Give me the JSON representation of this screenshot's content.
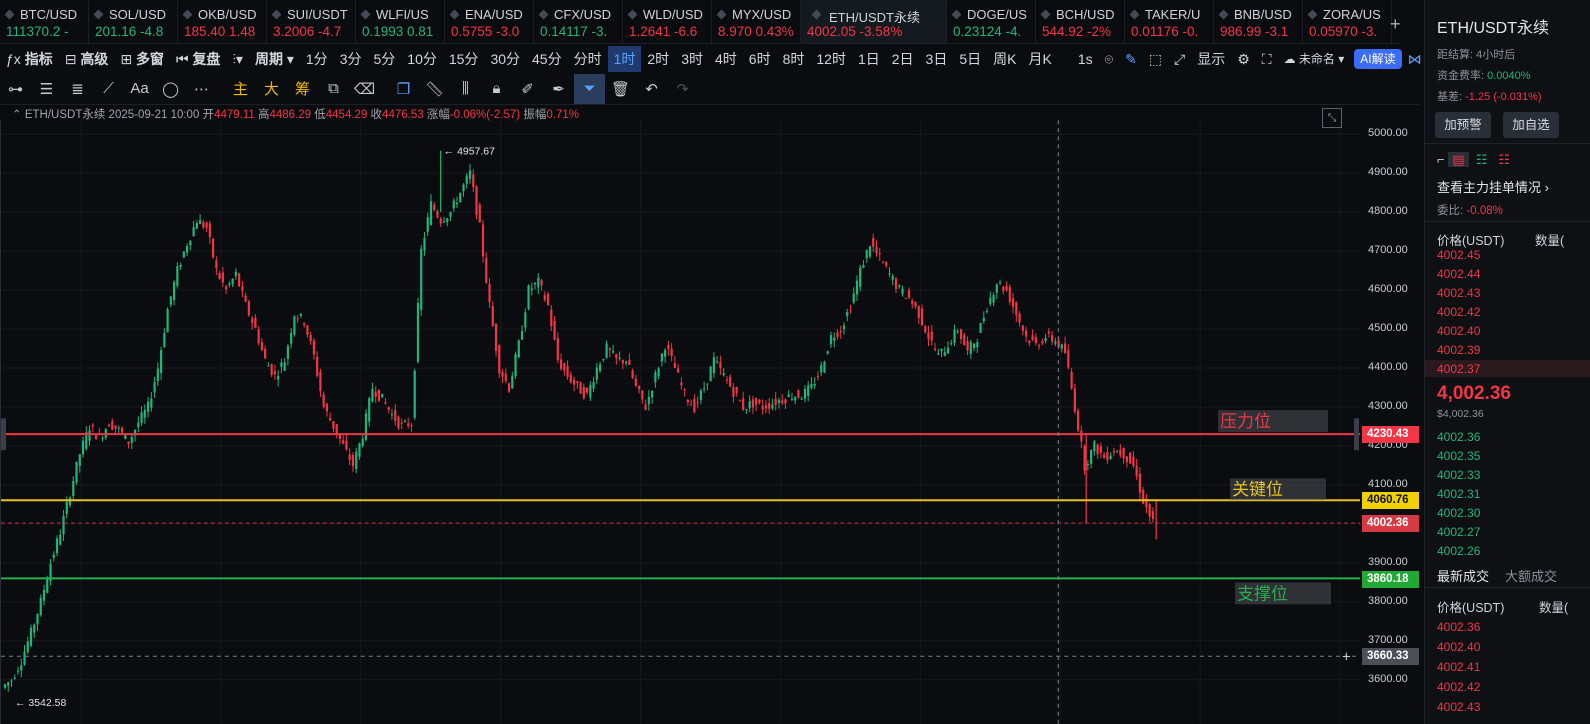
{
  "tickers": [
    {
      "sym": "BTC/USD",
      "val": "111370.2 -",
      "color": "#1fb67a"
    },
    {
      "sym": "SOL/USD",
      "val": "201.16 -4.8",
      "color": "#1fb67a"
    },
    {
      "sym": "OKB/USD",
      "val": "185.40 1.48",
      "color": "#f23645"
    },
    {
      "sym": "SUI/USDT",
      "val": "3.2006 -4.7",
      "color": "#f23645"
    },
    {
      "sym": "WLFI/US",
      "val": "0.1993 0.81",
      "color": "#1fb67a"
    },
    {
      "sym": "ENA/USD",
      "val": "0.5755 -3.0",
      "color": "#f23645"
    },
    {
      "sym": "CFX/USD",
      "val": "0.14117 -3.",
      "color": "#1fb67a"
    },
    {
      "sym": "WLD/USD",
      "val": "1.2641 -6.6",
      "color": "#f23645"
    },
    {
      "sym": "MYX/USD",
      "val": "8.970 0.43%",
      "color": "#f23645"
    },
    {
      "sym": "ETH/USDT永续",
      "val": "4002.05 -3.58%",
      "color": "#f23645",
      "active": true
    },
    {
      "sym": "DOGE/US",
      "val": "0.23124 -4.",
      "color": "#1fb67a"
    },
    {
      "sym": "BCH/USD",
      "val": "544.92 -2%",
      "color": "#f23645"
    },
    {
      "sym": "TAKER/U",
      "val": "0.01176 -0.",
      "color": "#f23645"
    },
    {
      "sym": "BNB/USD",
      "val": "986.99 -3.1",
      "color": "#f23645"
    },
    {
      "sym": "ZORA/US",
      "val": "0.05970 -3.",
      "color": "#f23645"
    }
  ],
  "toolbar1": {
    "indicator": "指标",
    "advanced": "高级",
    "multi": "多窗",
    "replay": "复盘",
    "period": "周期",
    "intervals": [
      "1分",
      "3分",
      "5分",
      "10分",
      "15分",
      "30分",
      "45分",
      "分时",
      "1时",
      "2时",
      "3时",
      "4时",
      "6时",
      "8时",
      "12时",
      "1日",
      "2日",
      "3日",
      "5日",
      "周K",
      "月K"
    ],
    "active_interval": "1时",
    "sec": "1s",
    "display": "显示",
    "unnamed": "未命名",
    "ai": "AI解读"
  },
  "toolbar2": {
    "main": "主",
    "big": "大",
    "chip": "筹",
    "text_tool": "Aa"
  },
  "info": {
    "pair": "ETH/USDT永续",
    "time": "2025-09-21 10:00",
    "open_l": "开",
    "open": "4479.11",
    "high_l": "高",
    "high": "4486.29",
    "low_l": "低",
    "low": "4454.29",
    "close_l": "收",
    "close": "4476.53",
    "chg_l": "涨幅",
    "chg": "-0.06%(-2.57)",
    "amp_l": "振幅",
    "amp": "0.71%"
  },
  "chart_data": {
    "type": "line",
    "title": "ETH/USDT永续 1时",
    "ylim": [
      3560,
      5040
    ],
    "yticks": [
      5000,
      4900,
      4800,
      4700,
      4600,
      4500,
      4400,
      4300,
      4200,
      4100,
      4000,
      3900,
      3800,
      3700,
      3600
    ],
    "high_marker": "4957.67",
    "low_marker": "3542.58",
    "levels": [
      {
        "name": "压力位",
        "value": 4230.43,
        "label": "4230.43",
        "color": "#f23645"
      },
      {
        "name": "关键位",
        "value": 4060.76,
        "label": "4060.76",
        "color": "#e6c31e"
      },
      {
        "name": "支撑位",
        "value": 3860.18,
        "label": "3860.18",
        "color": "#22b14c"
      }
    ],
    "last_price": {
      "value": 4002.36,
      "label": "4002.36"
    },
    "crosshair": {
      "value": 3660.33,
      "label": "3660.33"
    },
    "series": [
      {
        "values": [
          3580,
          3600,
          3650,
          3720,
          3800,
          3900,
          3980,
          4080,
          4180,
          4250,
          4220,
          4260,
          4240,
          4210,
          4260,
          4300,
          4400,
          4550,
          4650,
          4720,
          4780,
          4760,
          4650,
          4600,
          4640,
          4560,
          4500,
          4420,
          4380,
          4420,
          4540,
          4520,
          4430,
          4300,
          4250,
          4200,
          4150,
          4230,
          4350,
          4320,
          4280,
          4250,
          4260,
          4700,
          4820,
          4780,
          4800,
          4850,
          4900,
          4760,
          4560,
          4400,
          4350,
          4460,
          4600,
          4620,
          4560,
          4420,
          4380,
          4350,
          4330,
          4400,
          4450,
          4420,
          4420,
          4350,
          4300,
          4380,
          4460,
          4400,
          4330,
          4300,
          4350,
          4420,
          4380,
          4340,
          4300,
          4310,
          4300,
          4310,
          4320,
          4330,
          4330,
          4350,
          4400,
          4480,
          4500,
          4560,
          4650,
          4720,
          4680,
          4640,
          4600,
          4580,
          4540,
          4480,
          4430,
          4460,
          4500,
          4440,
          4480,
          4560,
          4620,
          4600,
          4540,
          4480,
          4460,
          4480,
          4470,
          4440,
          4300,
          4150,
          4200,
          4170,
          4190,
          4180,
          4150,
          4060,
          4002
        ]
      }
    ]
  },
  "right_panel": {
    "title": "ETH/USDT永续",
    "settle_l": "距结算:",
    "settle": "4小时后",
    "fund_l": "资金费率:",
    "fund": "0.0040%",
    "basis_l": "基差:",
    "basis": "-1.25 (-0.031%)",
    "alert_btn": "加预警",
    "watch_btn": "加自选",
    "view_orders": "查看主力挂单情况",
    "ratio_l": "委比:",
    "ratio": "-0.08%",
    "price_col": "价格(USDT)",
    "qty_col": "数量(",
    "asks": [
      "4002.45",
      "4002.44",
      "4002.43",
      "4002.42",
      "4002.40",
      "4002.39",
      "4002.37"
    ],
    "mid": "4,002.36",
    "mid_sub": "$4,002.36",
    "bids": [
      "4002.36",
      "4002.35",
      "4002.33",
      "4002.31",
      "4002.30",
      "4002.27",
      "4002.26"
    ],
    "trades_tab": "最新成交",
    "big_trades_tab": "大额成交",
    "trades": [
      "4002.36",
      "4002.40",
      "4002.41",
      "4002.42",
      "4002.43"
    ]
  }
}
